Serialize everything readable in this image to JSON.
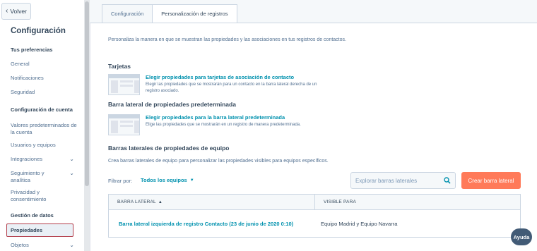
{
  "sidebar": {
    "back_label": "Volver",
    "title": "Configuración",
    "sections": [
      {
        "label": "Tus preferencias"
      },
      {
        "label": "Configuración de cuenta"
      },
      {
        "label": "Gestión de datos"
      }
    ],
    "items": [
      {
        "label": "General"
      },
      {
        "label": "Notificaciones"
      },
      {
        "label": "Seguridad"
      },
      {
        "label": "Valores predeterminados de la cuenta"
      },
      {
        "label": "Usuarios y equipos"
      },
      {
        "label": "Integraciones",
        "expandable": true
      },
      {
        "label": "Seguimiento y analítica",
        "expandable": true
      },
      {
        "label": "Privacidad y consentimiento"
      },
      {
        "label": "Propiedades",
        "active": true
      },
      {
        "label": "Objetos",
        "expandable": true
      }
    ]
  },
  "tabs": [
    {
      "label": "Configuración"
    },
    {
      "label": "Personalización de registros",
      "active": true
    }
  ],
  "content": {
    "intro": "Personaliza la manera en que se muestran las propiedades y las asociaciones en tus registros de contactos.",
    "cards_section": {
      "title": "Tarjetas",
      "link": "Elegir propiedades para tarjetas de asociación de contacto",
      "desc": "Elegir las propiedades que se mostrarán para un contacto en la barra lateral derecha de un registro asociado."
    },
    "default_sidebar_section": {
      "title": "Barra lateral de propiedades predeterminada",
      "link": "Elegir propiedades para la barra lateral predeterminada",
      "desc": "Elige las propiedades que se mostrarán en un registro de manera predeterminada."
    },
    "team_section": {
      "title": "Barras laterales de propiedades de equipo",
      "desc": "Crea barras laterales de equipo para personalizar las propiedades visibles para equipos específicos."
    },
    "filter": {
      "label": "Filtrar por:",
      "value": "Todos los equipos"
    },
    "search": {
      "placeholder": "Explorar barras laterales"
    },
    "create_button": "Crear barra lateral",
    "table": {
      "headers": [
        "BARRA LATERAL",
        "VISIBLE PARA"
      ],
      "rows": [
        [
          "Barra lateral izquierda de registro Contacto (23 de junio de 2020 0:10)",
          "Equipo Madrid y Equipo Navarra"
        ]
      ]
    }
  },
  "help_button": "Ayuda",
  "colors": {
    "accent_link": "#0091ae",
    "primary_button": "#ff7a59",
    "text_dark": "#33475b",
    "active_outline": "#b23c4a"
  },
  "icons": {
    "back": "chevron-left-icon",
    "expand": "chevron-down-icon",
    "sort": "sort-up-icon",
    "search": "search-icon",
    "dropdown": "caret-down-icon"
  }
}
